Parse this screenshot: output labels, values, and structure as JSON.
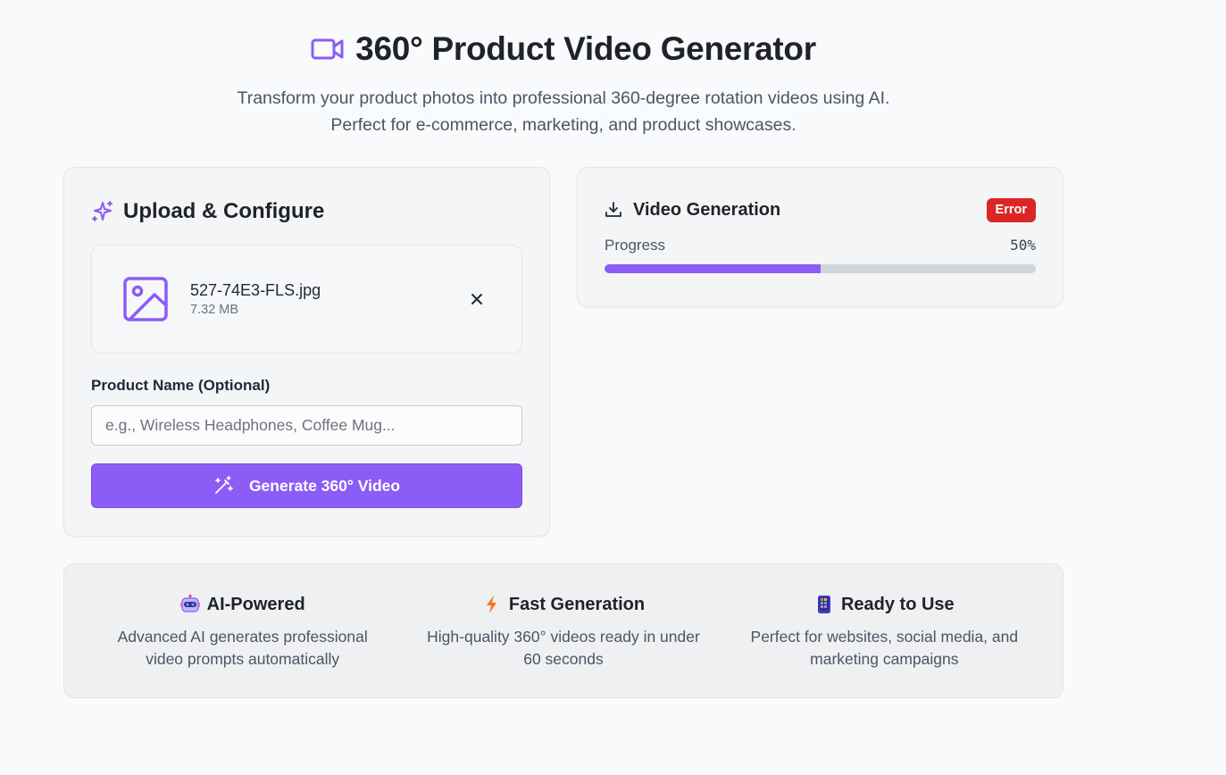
{
  "header": {
    "title": "360° Product Video Generator",
    "subtitle_line1": "Transform your product photos into professional 360-degree rotation videos using AI.",
    "subtitle_line2": "Perfect for e-commerce, marketing, and product showcases."
  },
  "upload": {
    "title": "Upload & Configure",
    "file_name": "527-74E3-FLS.jpg",
    "file_size": "7.32 MB",
    "product_label": "Product Name (Optional)",
    "product_value": "",
    "product_placeholder": "e.g., Wireless Headphones, Coffee Mug...",
    "generate_label": "Generate 360° Video"
  },
  "video": {
    "title": "Video Generation",
    "status": "Error",
    "progress_label": "Progress",
    "progress_text": "50%",
    "progress_fraction": 0.5
  },
  "features": [
    {
      "icon": "robot-icon",
      "title": "AI-Powered",
      "desc": "Advanced AI generates professional video prompts automatically"
    },
    {
      "icon": "lightning-icon",
      "title": "Fast Generation",
      "desc": "High-quality 360° videos ready in under 60 seconds"
    },
    {
      "icon": "mobile-phone-icon",
      "title": "Ready to Use",
      "desc": "Perfect for websites, social media, and marketing campaigns"
    }
  ],
  "colors": {
    "accent": "#8b5cf6",
    "error": "#dc2626",
    "progress_track": "#d1d5db"
  }
}
